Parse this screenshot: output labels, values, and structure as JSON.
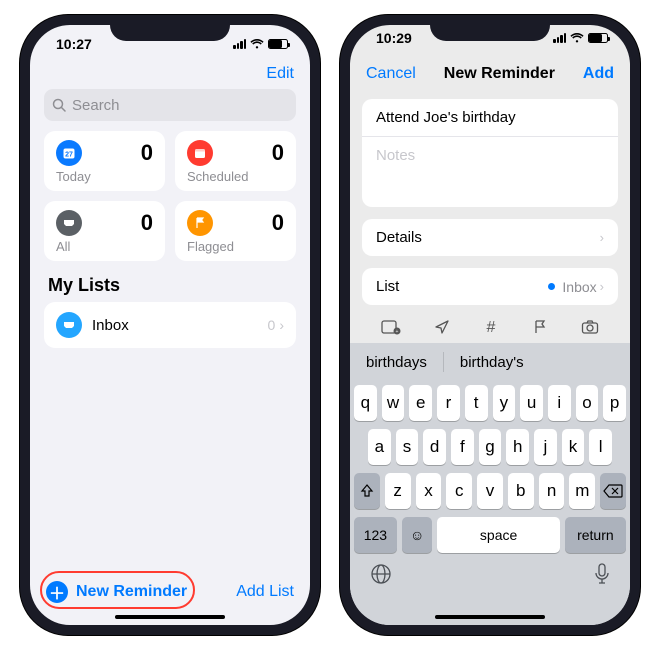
{
  "left": {
    "status_time": "10:27",
    "edit": "Edit",
    "search_placeholder": "Search",
    "cards": {
      "today": {
        "label": "Today",
        "count": "0"
      },
      "scheduled": {
        "label": "Scheduled",
        "count": "0"
      },
      "all": {
        "label": "All",
        "count": "0"
      },
      "flagged": {
        "label": "Flagged",
        "count": "0"
      }
    },
    "mylists_header": "My Lists",
    "inbox": {
      "name": "Inbox",
      "count": "0"
    },
    "new_reminder": "New Reminder",
    "add_list": "Add List"
  },
  "right": {
    "status_time": "10:29",
    "cancel": "Cancel",
    "title": "New Reminder",
    "add": "Add",
    "reminder_title": "Attend Joe's birthday",
    "notes_placeholder": "Notes",
    "details": "Details",
    "list": "List",
    "list_value": "Inbox",
    "suggestions": [
      "birthdays",
      "birthday's"
    ],
    "keys_r1": [
      "q",
      "w",
      "e",
      "r",
      "t",
      "y",
      "u",
      "i",
      "o",
      "p"
    ],
    "keys_r2": [
      "a",
      "s",
      "d",
      "f",
      "g",
      "h",
      "j",
      "k",
      "l"
    ],
    "keys_r3": [
      "z",
      "x",
      "c",
      "v",
      "b",
      "n",
      "m"
    ],
    "key_123": "123",
    "key_space": "space",
    "key_return": "return"
  }
}
